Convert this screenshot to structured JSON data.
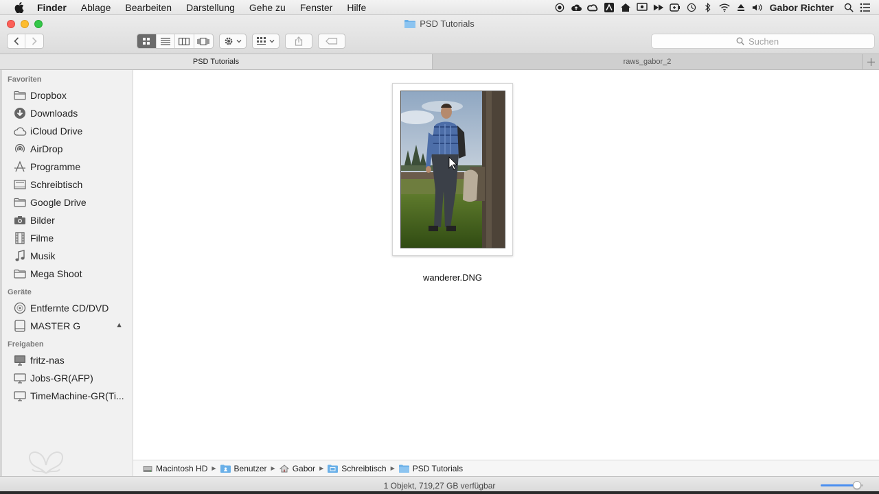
{
  "menubar": {
    "app_name": "Finder",
    "items": [
      "Ablage",
      "Bearbeiten",
      "Darstellung",
      "Gehe zu",
      "Fenster",
      "Hilfe"
    ],
    "user_name": "Gabor Richter",
    "status_icons": [
      "record-icon",
      "cloud-upload-icon",
      "creative-cloud-icon",
      "app-icon",
      "home-icon",
      "airplay-icon",
      "forward-icon",
      "battery-monitor-icon",
      "time-machine-icon",
      "bluetooth-icon",
      "wifi-icon",
      "eject-icon",
      "volume-icon"
    ]
  },
  "window": {
    "title": "PSD Tutorials"
  },
  "toolbar": {
    "view_modes": [
      "icon-view",
      "list-view",
      "column-view",
      "coverflow-view"
    ],
    "active_view": "icon-view"
  },
  "search": {
    "placeholder": "Suchen"
  },
  "tabs": [
    {
      "label": "PSD Tutorials",
      "active": true
    },
    {
      "label": "raws_gabor_2",
      "active": false
    }
  ],
  "sidebar": {
    "sections": [
      {
        "title": "Favoriten",
        "items": [
          {
            "label": "Dropbox",
            "icon": "folder-icon"
          },
          {
            "label": "Downloads",
            "icon": "downloads-icon"
          },
          {
            "label": "iCloud Drive",
            "icon": "cloud-icon"
          },
          {
            "label": "AirDrop",
            "icon": "airdrop-icon"
          },
          {
            "label": "Programme",
            "icon": "applications-icon"
          },
          {
            "label": "Schreibtisch",
            "icon": "desktop-icon"
          },
          {
            "label": "Google Drive",
            "icon": "folder-icon"
          },
          {
            "label": "Bilder",
            "icon": "camera-icon"
          },
          {
            "label": "Filme",
            "icon": "film-icon"
          },
          {
            "label": "Musik",
            "icon": "music-icon"
          },
          {
            "label": "Mega Shoot",
            "icon": "folder-icon"
          }
        ]
      },
      {
        "title": "Geräte",
        "items": [
          {
            "label": "Entfernte CD/DVD",
            "icon": "disc-icon"
          },
          {
            "label": "MASTER G",
            "icon": "drive-icon",
            "eject": true
          }
        ]
      },
      {
        "title": "Freigaben",
        "items": [
          {
            "label": "fritz-nas",
            "icon": "server-icon"
          },
          {
            "label": "Jobs-GR(AFP)",
            "icon": "network-drive-icon"
          },
          {
            "label": "TimeMachine-GR(Ti...",
            "icon": "network-drive-icon"
          }
        ]
      }
    ]
  },
  "files": [
    {
      "name": "wanderer.DNG"
    }
  ],
  "pathbar": [
    "Macintosh HD",
    "Benutzer",
    "Gabor",
    "Schreibtisch",
    "PSD Tutorials"
  ],
  "status": {
    "text": "1 Objekt, 719,27 GB verfügbar",
    "zoom_level": 0.85
  },
  "colors": {
    "accent": "#4a8ef0",
    "folder": "#6ab0e8"
  }
}
